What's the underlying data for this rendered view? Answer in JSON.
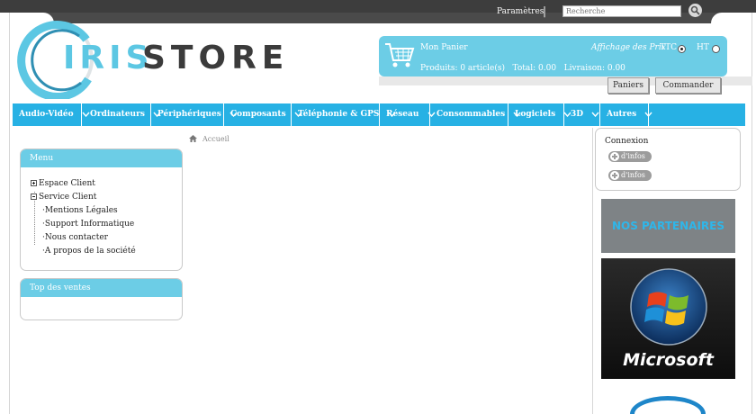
{
  "topbar": {
    "params_label": "Paramètres",
    "search_placeholder": "Recherche"
  },
  "logo": {
    "part1": "IRIS",
    "part2": "STORE",
    "accent_color": "#5cc7e3",
    "dark_color": "#3b3b3b"
  },
  "cart": {
    "title": "Mon Panier",
    "price_display_label": "Affichage des Prix",
    "ttc_label": "TTC",
    "ht_label": "HT",
    "selected": "TTC",
    "summary": "Produits: 0 article(s)   Total: 0.00   Livraison: 0.00",
    "paniers_button": "Paniers",
    "commander_button": "Commander",
    "color": "#6ccde6"
  },
  "nav": {
    "color": "#27b1e4",
    "items": [
      {
        "label": "Audio-Vidéo"
      },
      {
        "label": "Ordinateurs"
      },
      {
        "label": "Périphériques"
      },
      {
        "label": "Composants"
      },
      {
        "label": "Téléphonie & GPS"
      },
      {
        "label": "Réseau"
      },
      {
        "label": "Consommables"
      },
      {
        "label": "Logiciels"
      },
      {
        "label": "3D"
      },
      {
        "label": "Autres"
      }
    ]
  },
  "breadcrumb": {
    "home": "Accueil"
  },
  "menu_box": {
    "title": "Menu",
    "items": [
      {
        "label": "Espace Client",
        "expander": "plus"
      },
      {
        "label": "Service Client",
        "expander": "minus"
      },
      {
        "label": "Mentions Légales"
      },
      {
        "label": "Support Informatique"
      },
      {
        "label": "Nous contacter"
      },
      {
        "label": "A propos de la société"
      }
    ]
  },
  "top_sales_box": {
    "title": "Top des ventes"
  },
  "connexion_box": {
    "title": "Connexion",
    "more_info_1": "d'infos",
    "more_info_2": "d'infos"
  },
  "partners": {
    "banner": "NOS PARTENAIRES",
    "microsoft": "Microsoft"
  }
}
